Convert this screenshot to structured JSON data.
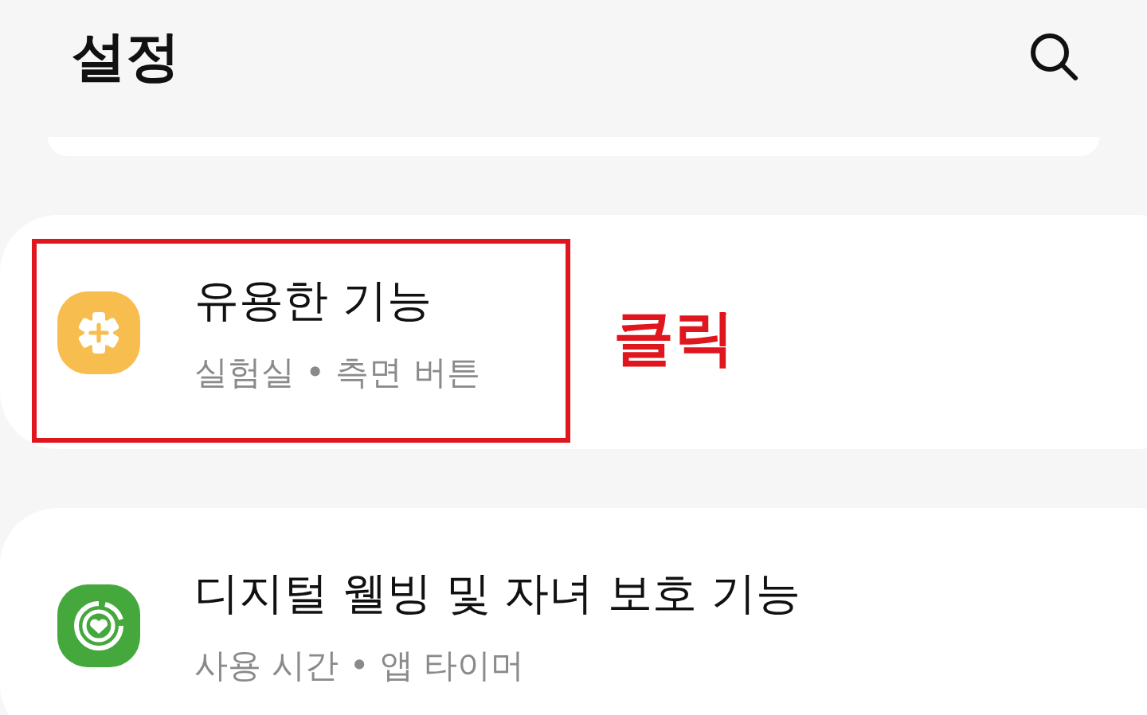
{
  "header": {
    "title": "설정"
  },
  "items": [
    {
      "kind": "gear-plus",
      "title": "유용한 기능",
      "subtitle": "실험실  •  측면 버튼",
      "highlighted": true,
      "callout": "클릭"
    },
    {
      "kind": "heart-ring",
      "title": "디지털 웰빙 및 자녀 보호 기능",
      "subtitle": "사용 시간  •  앱 타이머",
      "highlighted": false
    }
  ]
}
